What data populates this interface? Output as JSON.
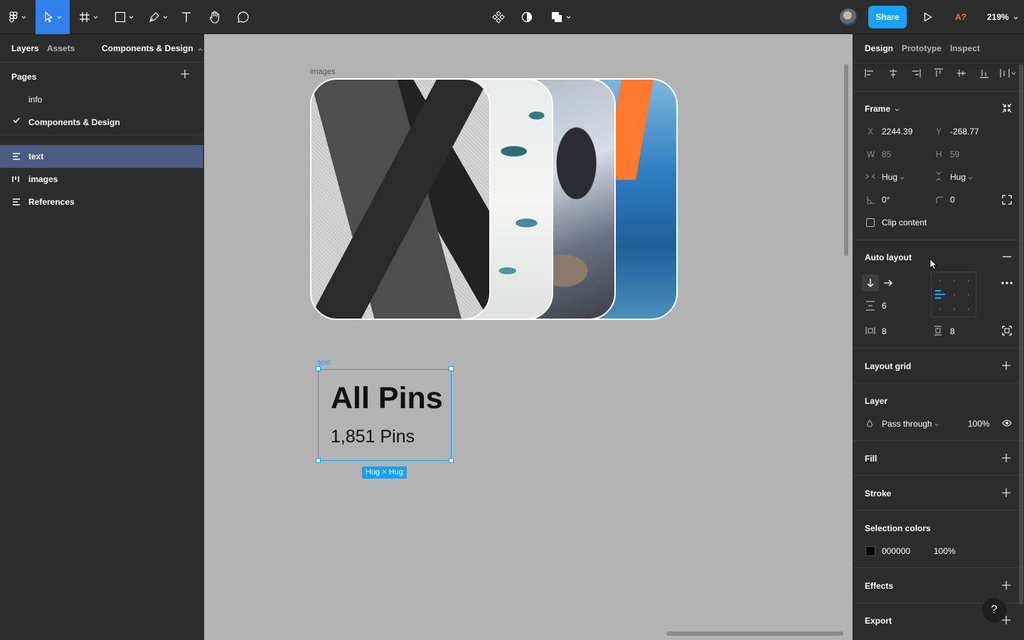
{
  "toolbar": {
    "share_label": "Share",
    "a_indicator": "A?",
    "zoom": "219%"
  },
  "left_panel": {
    "tabs": [
      "Layers",
      "Assets"
    ],
    "page_selector": "Components & Design",
    "pages_heading": "Pages",
    "pages": [
      "info",
      "Components & Design"
    ],
    "layers": [
      "text",
      "images",
      "References"
    ]
  },
  "canvas": {
    "images_frame_label": "images",
    "text_frame_label": "text",
    "title": "All Pins",
    "subtitle": "1,851 Pins",
    "size_badge": "Hug × Hug"
  },
  "right_panel": {
    "tabs": [
      "Design",
      "Prototype",
      "Inspect"
    ],
    "frame": {
      "heading": "Frame",
      "x_label": "X",
      "x": "2244.39",
      "y_label": "Y",
      "y": "-268.77",
      "w_label": "W",
      "w": "85",
      "h_label": "H",
      "h": "59",
      "horizontal_resizing": "Hug",
      "vertical_resizing": "Hug",
      "rotation": "0°",
      "corner_radius": "0",
      "clip_content_label": "Clip content",
      "clip_content": false
    },
    "auto_layout": {
      "heading": "Auto layout",
      "spacing": "6",
      "padding_horizontal": "8",
      "padding_vertical": "8"
    },
    "layout_grid": {
      "heading": "Layout grid"
    },
    "layer": {
      "heading": "Layer",
      "blend_mode": "Pass through",
      "opacity": "100%"
    },
    "fill": {
      "heading": "Fill"
    },
    "stroke": {
      "heading": "Stroke"
    },
    "selection_colors": {
      "heading": "Selection colors",
      "hex": "000000",
      "opacity": "100%",
      "color": "#000000"
    },
    "effects": {
      "heading": "Effects"
    },
    "export": {
      "heading": "Export"
    },
    "help_label": "?"
  },
  "colors": {
    "accent": "#18a0fb",
    "toolbar_active": "#2f80ed",
    "selected_layer": "#4a5b81",
    "panel_bg": "#2c2c2c",
    "canvas_bg": "#b3b3b3"
  }
}
